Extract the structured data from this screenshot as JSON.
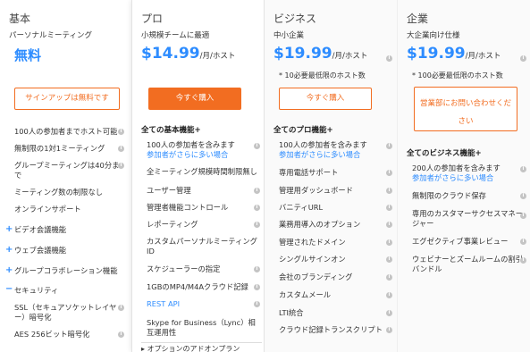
{
  "basic": {
    "name": "基本",
    "subtitle": "パーソナルミーティング",
    "price": "無料",
    "button": "サインアップは無料です",
    "features": [
      "100人の参加者までホスト可能",
      "無制限の1対1ミーティング",
      "グループミーティングは40分ま",
      "で",
      "ミーティング数の制限なし",
      "オンラインサポート"
    ],
    "expanders": [
      "ビデオ会議機能",
      "ウェブ会議機能",
      "グループコラボレーション機能"
    ],
    "security_label": "セキュリティ",
    "security_items": [
      "SSL（セキュアソケットレイヤ",
      "ー）暗号化",
      "AES 256ビット暗号化"
    ]
  },
  "pro": {
    "name": "プロ",
    "subtitle": "小規模チームに最適",
    "price": "$14.99",
    "unit": "/月/ホスト",
    "button": "今すぐ購入",
    "section": "全ての基本機能+",
    "features": [
      "100人の参加者を含みます",
      "参加者がさらに多い場合",
      "全ミーティング規模時間制限無し",
      "ユーザー管理",
      "管理者機能コントロール",
      "レポーティング",
      "カスタムパーソナルミーティング",
      "ID",
      "スケジューラーの指定",
      "1GBのMP4/M4Aクラウド記録",
      "REST API",
      "Skype for Business（Lync）相",
      "互運用性"
    ],
    "bottom": "オプションのアドオンプラン"
  },
  "business": {
    "name": "ビジネス",
    "subtitle": "中小企業",
    "price": "$19.99",
    "unit": "/月/ホスト",
    "note": "* 10必要最低限のホスト数",
    "button": "今すぐ購入",
    "section": "全てのプロ機能+",
    "features": [
      "100人の参加者を含みます",
      "参加者がさらに多い場合",
      "専用電話サポート",
      "管理用ダッシュボード",
      "バニティURL",
      "業務用導入のオプション",
      "管理されたドメイン",
      "シングルサインオン",
      "会社のブランディング",
      "カスタムメール",
      "LTI統合",
      "クラウド記録トランスクリプト"
    ]
  },
  "enterprise": {
    "name": "企業",
    "subtitle": "大企業向け仕様",
    "price": "$19.99",
    "unit": "/月/ホスト",
    "note": "* 100必要最低限のホスト数",
    "button_line1": "営業部にお問い合わせくだ",
    "button_line2": "さい",
    "section": "全てのビジネス機能+",
    "features": [
      "200人の参加者を含みます",
      "参加者がさらに多い場合",
      "無制限のクラウド保存",
      "専用のカスタマーサクセスマネー",
      "ジャー",
      "エグゼクティブ事業レビュー",
      "ウェビナーとズームルームの割引",
      "バンドル"
    ]
  },
  "colors": {
    "accent_blue": "#2d8cff",
    "accent_orange": "#f26d21"
  }
}
